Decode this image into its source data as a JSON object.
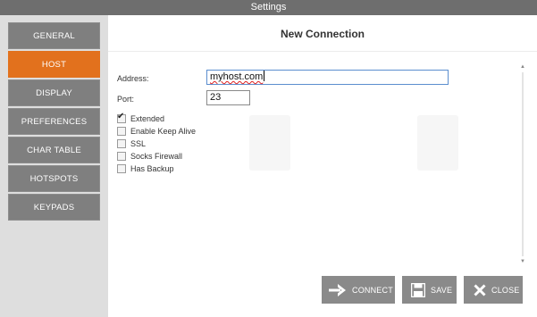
{
  "window": {
    "title": "Settings"
  },
  "sidebar": {
    "items": [
      {
        "label": "GENERAL",
        "active": false
      },
      {
        "label": "HOST",
        "active": true
      },
      {
        "label": "DISPLAY",
        "active": false
      },
      {
        "label": "PREFERENCES",
        "active": false
      },
      {
        "label": "CHAR TABLE",
        "active": false
      },
      {
        "label": "HOTSPOTS",
        "active": false
      },
      {
        "label": "KEYPADS",
        "active": false
      }
    ]
  },
  "panel": {
    "title": "New Connection",
    "address": {
      "label": "Address:",
      "value": "myhost.com"
    },
    "port": {
      "label": "Port:",
      "value": "23"
    },
    "options": [
      {
        "label": "Extended",
        "checked": true
      },
      {
        "label": "Enable Keep Alive",
        "checked": false
      },
      {
        "label": "SSL",
        "checked": false
      },
      {
        "label": "Socks Firewall",
        "checked": false
      },
      {
        "label": "Has Backup",
        "checked": false
      }
    ]
  },
  "actions": {
    "connect": {
      "label": "CONNECT",
      "icon": "arrow-right-icon"
    },
    "save": {
      "label": "SAVE",
      "icon": "floppy-disk-icon"
    },
    "close": {
      "label": "CLOSE",
      "icon": "close-x-icon"
    }
  },
  "colors": {
    "accent": "#e2711d",
    "nav_bg": "#7f7f7f",
    "button_bg": "#8a8a8a",
    "titlebar_bg": "#6e6e6e"
  }
}
